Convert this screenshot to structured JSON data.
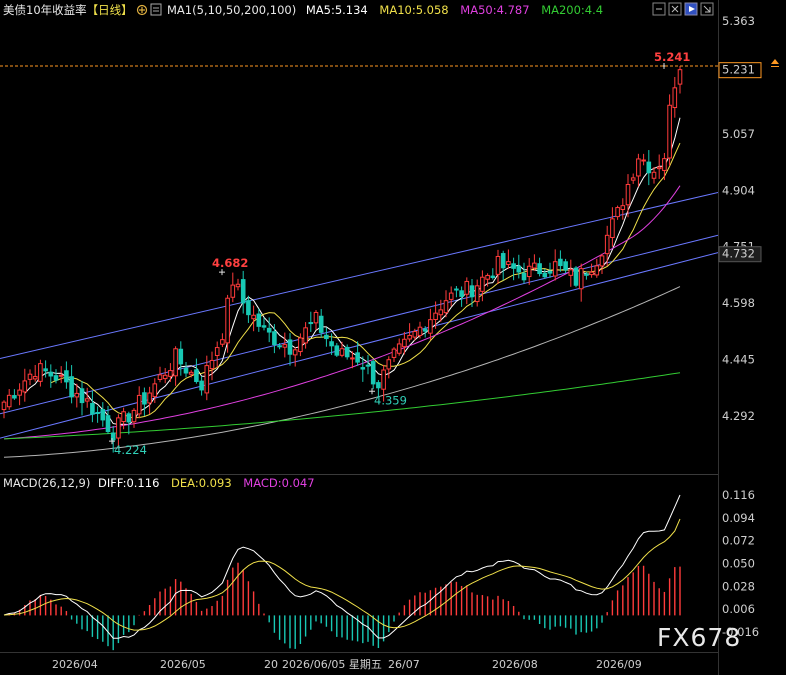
{
  "header": {
    "title": "美债10年收益率",
    "period": "【日线】",
    "ma_label": "MA1(5,10,50,200,100)",
    "ma5": "MA5:5.134",
    "ma10": "MA10:5.058",
    "ma50": "MA50:4.787",
    "ma200": "MA200:4.4"
  },
  "macd_header": {
    "label": "MACD(26,12,9)",
    "diff": "DIFF:0.116",
    "dea": "DEA:0.093",
    "macd": "MACD:0.047"
  },
  "colors": {
    "up": "#ff3b3b",
    "down": "#18c8b4",
    "ma5": "#ffffff",
    "ma10": "#f0e04a",
    "ma50": "#e040e0",
    "ma100": "#b4b4b4",
    "ma200": "#33cc33",
    "channel": "#6a78ff",
    "current": "#ff9922"
  },
  "chart_data": [
    {
      "type": "candlestick",
      "ylim": [
        4.22,
        5.37
      ],
      "price_ticks": [
        "5.363",
        "5.210",
        "5.057",
        "4.904",
        "4.751",
        "4.598",
        "4.445",
        "4.292"
      ],
      "current_price": "5.231",
      "channel_label": "4.732",
      "annotations": [
        {
          "text": "5.241",
          "value": 5.241,
          "kind": "high"
        },
        {
          "text": "4.682",
          "value": 4.682,
          "kind": "high"
        },
        {
          "text": "4.359",
          "value": 4.359,
          "kind": "low"
        },
        {
          "text": "4.224",
          "value": 4.224,
          "kind": "low"
        }
      ],
      "date_labels": [
        "2026/04",
        "2026/05",
        "20",
        "2026/06/05 星期五",
        "26/07",
        "2026/08",
        "2026/09"
      ],
      "ma_visible_series": [
        "MA5",
        "MA10",
        "MA50",
        "MA100",
        "MA200"
      ]
    },
    {
      "type": "macd",
      "ylim": [
        -0.04,
        0.122
      ],
      "ticks": [
        "0.116",
        "0.094",
        "0.072",
        "0.050",
        "0.028",
        "0.006",
        "-0.016"
      ],
      "diff_last": 0.116,
      "dea_last": 0.093,
      "macd_last": 0.047
    }
  ],
  "watermark": {
    "text": "FX678"
  }
}
